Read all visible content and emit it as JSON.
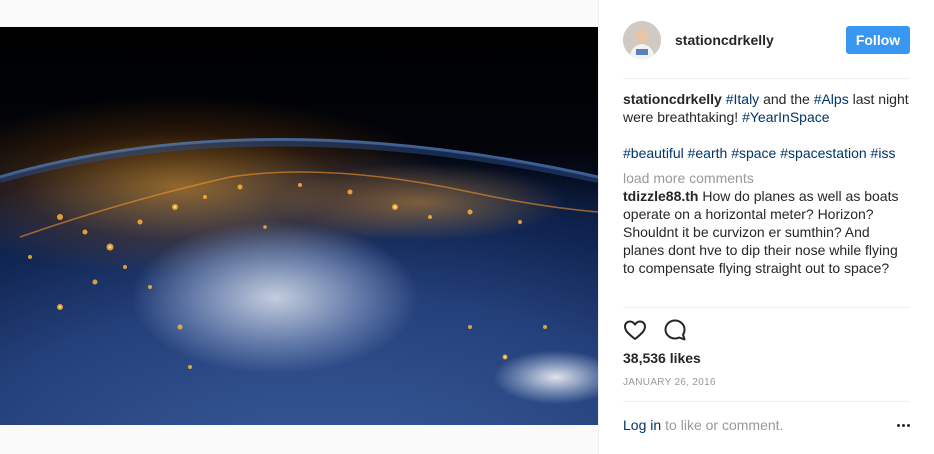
{
  "photo": {
    "alt": "Night view of Italy and the Alps from space"
  },
  "post": {
    "username": "stationcdrkelly",
    "follow_label": "Follow",
    "caption": {
      "author": "stationcdrkelly",
      "segments": [
        {
          "type": "tag",
          "text": "#Italy"
        },
        {
          "type": "text",
          "text": " and the "
        },
        {
          "type": "tag",
          "text": "#Alps"
        },
        {
          "type": "text",
          "text": " last night were breathtaking! "
        },
        {
          "type": "tag",
          "text": "#YearInSpace"
        }
      ],
      "tags": [
        "#beautiful",
        "#earth",
        "#space",
        "#spacestation",
        "#iss"
      ]
    },
    "load_more_label": "load more comments",
    "comments": [
      {
        "author": "tdizzle88.th",
        "text": "How do planes as well as boats operate on a horizontal meter? Horizon? Shouldnt it be curvizon er sumthin? And planes dont hve to dip their nose while flying to compensate flying straight out to space?"
      }
    ],
    "likes_label": "38,536 likes",
    "date_label": "JANUARY 26, 2016",
    "login_link": "Log in",
    "login_suffix": "to like or comment."
  },
  "icons": {
    "like": "heart-outline-icon",
    "comment": "speech-bubble-icon",
    "more": "more-options-icon"
  },
  "colors": {
    "follow_button": "#3897f0",
    "hashtag": "#003569",
    "muted": "#999999",
    "text": "#262626"
  }
}
